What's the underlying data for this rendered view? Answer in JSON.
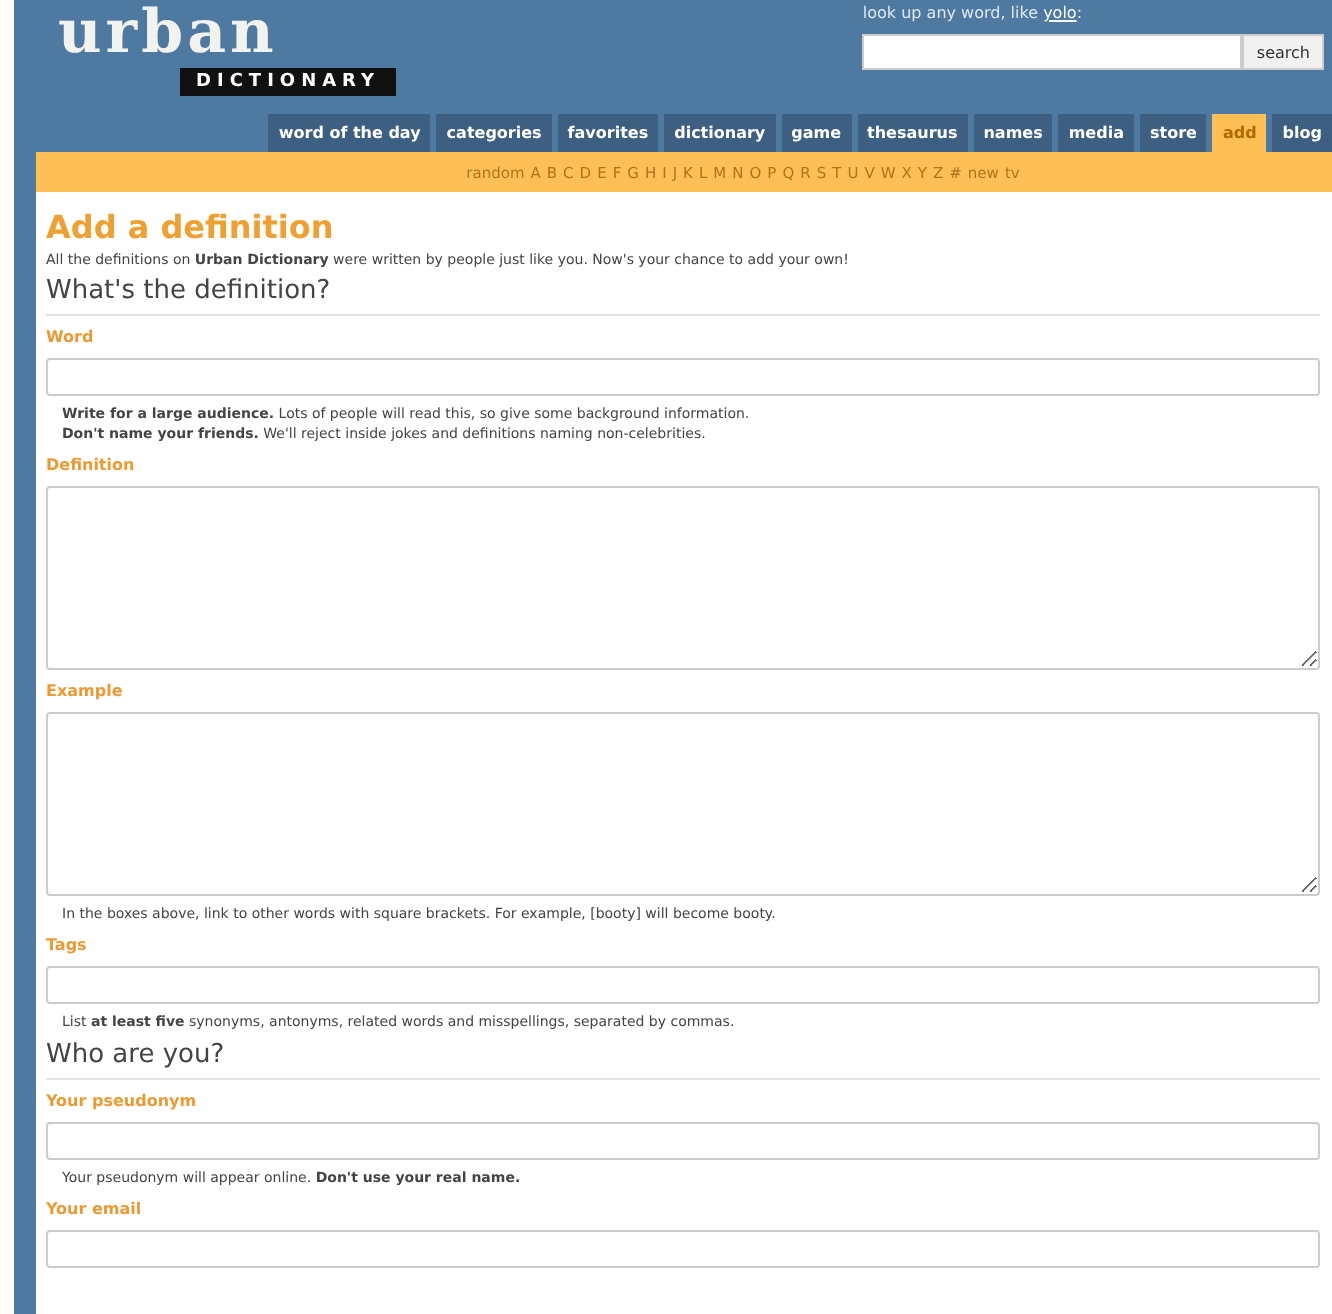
{
  "logo": {
    "word": "urban",
    "sub": "DICTIONARY"
  },
  "search": {
    "prompt": "look up any word, like",
    "example": "yolo",
    "colon": ":",
    "button": "search"
  },
  "nav": [
    {
      "label": "word of the day",
      "selected": false
    },
    {
      "label": "categories",
      "selected": false
    },
    {
      "label": "favorites",
      "selected": false
    },
    {
      "label": "dictionary",
      "selected": false
    },
    {
      "label": "game",
      "selected": false
    },
    {
      "label": "thesaurus",
      "selected": false
    },
    {
      "label": "names",
      "selected": false
    },
    {
      "label": "media",
      "selected": false
    },
    {
      "label": "store",
      "selected": false
    },
    {
      "label": "add",
      "selected": true
    },
    {
      "label": "blog",
      "selected": false
    }
  ],
  "letters": [
    "random",
    "A",
    "B",
    "C",
    "D",
    "E",
    "F",
    "G",
    "H",
    "I",
    "J",
    "K",
    "L",
    "M",
    "N",
    "O",
    "P",
    "Q",
    "R",
    "S",
    "T",
    "U",
    "V",
    "W",
    "X",
    "Y",
    "Z",
    "#",
    "new",
    "tv"
  ],
  "title": "Add a definition",
  "intro": "All the definitions on **Urban Dictionary** were written by people just like you. Now's your chance to add your own!",
  "sections": [
    {
      "heading": "What's the definition?",
      "fields": [
        {
          "label": "Word",
          "kind": "input",
          "hints": [
            "**Write for a large audience.** Lots of people will read this, so give some background information.",
            "**Don't name your friends.** We'll reject inside jokes and definitions naming non-celebrities."
          ]
        },
        {
          "label": "Definition",
          "kind": "textarea"
        },
        {
          "label": "Example",
          "kind": "textarea",
          "hints": [
            "In the boxes above, link to other words with square brackets. For example, [booty] will become booty."
          ]
        },
        {
          "label": "Tags",
          "kind": "input",
          "hints": [
            "List **at least five** synonyms, antonyms, related words and misspellings, separated by commas."
          ]
        }
      ]
    },
    {
      "heading": "Who are you?",
      "fields": [
        {
          "label": "Your pseudonym",
          "kind": "input",
          "hints": [
            "Your pseudonym will appear online. **Don't use your real name.**"
          ]
        },
        {
          "label": "Your email",
          "kind": "input"
        }
      ]
    }
  ]
}
